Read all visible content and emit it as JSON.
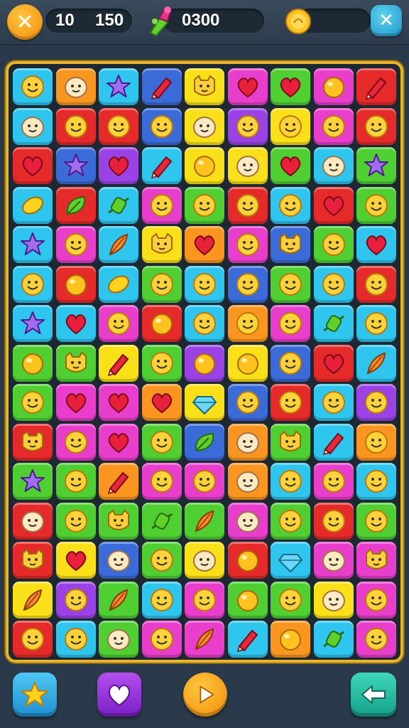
{
  "header": {
    "close_left_label": "✕",
    "close_right_label": "✕",
    "moves": "10",
    "score": "150",
    "gems": "0300",
    "gem_icon": "gem-bundle-icon",
    "coin_icon": "gold-coin-icon"
  },
  "colors": {
    "c": "#2ec6ee",
    "o": "#fa9620",
    "b": "#3a6bd8",
    "y": "#fae018",
    "m": "#e93dcc",
    "g": "#4fcf32",
    "r": "#e62a2a",
    "p": "#9a42e6"
  },
  "board": {
    "rows": [
      [
        {
          "bg": "c",
          "icon": "smiley"
        },
        {
          "bg": "o",
          "icon": "face"
        },
        {
          "bg": "c",
          "icon": "star"
        },
        {
          "bg": "b",
          "icon": "crayon"
        },
        {
          "bg": "y",
          "icon": "cat"
        },
        {
          "bg": "m",
          "icon": "heart"
        },
        {
          "bg": "g",
          "icon": "heart"
        },
        {
          "bg": "m",
          "icon": "ball"
        },
        {
          "bg": "r",
          "icon": "crayon"
        }
      ],
      [
        {
          "bg": "c",
          "icon": "face"
        },
        {
          "bg": "r",
          "icon": "smiley"
        },
        {
          "bg": "r",
          "icon": "smiley"
        },
        {
          "bg": "b",
          "icon": "smiley"
        },
        {
          "bg": "y",
          "icon": "face"
        },
        {
          "bg": "p",
          "icon": "smiley"
        },
        {
          "bg": "y",
          "icon": "smiley"
        },
        {
          "bg": "m",
          "icon": "smiley"
        },
        {
          "bg": "r",
          "icon": "smiley"
        }
      ],
      [
        {
          "bg": "r",
          "icon": "heart"
        },
        {
          "bg": "b",
          "icon": "star"
        },
        {
          "bg": "p",
          "icon": "heart"
        },
        {
          "bg": "c",
          "icon": "crayon"
        },
        {
          "bg": "y",
          "icon": "ball"
        },
        {
          "bg": "y",
          "icon": "face"
        },
        {
          "bg": "g",
          "icon": "heart"
        },
        {
          "bg": "c",
          "icon": "face"
        },
        {
          "bg": "g",
          "icon": "star"
        }
      ],
      [
        {
          "bg": "c",
          "icon": "lemon"
        },
        {
          "bg": "r",
          "icon": "leaf"
        },
        {
          "bg": "c",
          "icon": "candy"
        },
        {
          "bg": "m",
          "icon": "smiley"
        },
        {
          "bg": "g",
          "icon": "smiley"
        },
        {
          "bg": "r",
          "icon": "smiley"
        },
        {
          "bg": "c",
          "icon": "smiley"
        },
        {
          "bg": "r",
          "icon": "heart"
        },
        {
          "bg": "g",
          "icon": "smiley"
        }
      ],
      [
        {
          "bg": "c",
          "icon": "star"
        },
        {
          "bg": "m",
          "icon": "smiley"
        },
        {
          "bg": "c",
          "icon": "feather"
        },
        {
          "bg": "y",
          "icon": "cat"
        },
        {
          "bg": "o",
          "icon": "heart"
        },
        {
          "bg": "m",
          "icon": "smiley"
        },
        {
          "bg": "b",
          "icon": "cat"
        },
        {
          "bg": "g",
          "icon": "smiley"
        },
        {
          "bg": "c",
          "icon": "heart"
        }
      ],
      [
        {
          "bg": "c",
          "icon": "smiley"
        },
        {
          "bg": "r",
          "icon": "ball"
        },
        {
          "bg": "c",
          "icon": "lemon"
        },
        {
          "bg": "g",
          "icon": "smiley"
        },
        {
          "bg": "c",
          "icon": "smiley"
        },
        {
          "bg": "b",
          "icon": "smiley"
        },
        {
          "bg": "g",
          "icon": "smiley"
        },
        {
          "bg": "c",
          "icon": "smiley"
        },
        {
          "bg": "r",
          "icon": "smiley"
        }
      ],
      [
        {
          "bg": "c",
          "icon": "star"
        },
        {
          "bg": "c",
          "icon": "heart"
        },
        {
          "bg": "m",
          "icon": "smiley"
        },
        {
          "bg": "r",
          "icon": "ball"
        },
        {
          "bg": "c",
          "icon": "smiley"
        },
        {
          "bg": "o",
          "icon": "smiley"
        },
        {
          "bg": "m",
          "icon": "smiley"
        },
        {
          "bg": "c",
          "icon": "candy"
        },
        {
          "bg": "c",
          "icon": "smiley"
        }
      ],
      [
        {
          "bg": "g",
          "icon": "ball"
        },
        {
          "bg": "g",
          "icon": "cat"
        },
        {
          "bg": "y",
          "icon": "crayon"
        },
        {
          "bg": "g",
          "icon": "smiley"
        },
        {
          "bg": "p",
          "icon": "ball"
        },
        {
          "bg": "y",
          "icon": "ball"
        },
        {
          "bg": "b",
          "icon": "smiley"
        },
        {
          "bg": "r",
          "icon": "heart"
        },
        {
          "bg": "c",
          "icon": "feather"
        }
      ],
      [
        {
          "bg": "g",
          "icon": "smiley"
        },
        {
          "bg": "m",
          "icon": "heart"
        },
        {
          "bg": "m",
          "icon": "heart"
        },
        {
          "bg": "o",
          "icon": "heart"
        },
        {
          "bg": "y",
          "icon": "gem"
        },
        {
          "bg": "b",
          "icon": "smiley"
        },
        {
          "bg": "r",
          "icon": "smiley"
        },
        {
          "bg": "c",
          "icon": "smiley"
        },
        {
          "bg": "p",
          "icon": "smiley"
        }
      ],
      [
        {
          "bg": "r",
          "icon": "cat"
        },
        {
          "bg": "m",
          "icon": "smiley"
        },
        {
          "bg": "m",
          "icon": "heart"
        },
        {
          "bg": "g",
          "icon": "smiley"
        },
        {
          "bg": "b",
          "icon": "leaf"
        },
        {
          "bg": "o",
          "icon": "face"
        },
        {
          "bg": "g",
          "icon": "cat"
        },
        {
          "bg": "c",
          "icon": "crayon"
        },
        {
          "bg": "o",
          "icon": "smiley"
        }
      ],
      [
        {
          "bg": "g",
          "icon": "star"
        },
        {
          "bg": "g",
          "icon": "smiley"
        },
        {
          "bg": "o",
          "icon": "crayon"
        },
        {
          "bg": "m",
          "icon": "smiley"
        },
        {
          "bg": "m",
          "icon": "smiley"
        },
        {
          "bg": "o",
          "icon": "face"
        },
        {
          "bg": "c",
          "icon": "smiley"
        },
        {
          "bg": "m",
          "icon": "smiley"
        },
        {
          "bg": "c",
          "icon": "smiley"
        }
      ],
      [
        {
          "bg": "r",
          "icon": "face"
        },
        {
          "bg": "g",
          "icon": "smiley"
        },
        {
          "bg": "g",
          "icon": "cat"
        },
        {
          "bg": "g",
          "icon": "candy"
        },
        {
          "bg": "g",
          "icon": "feather"
        },
        {
          "bg": "m",
          "icon": "face"
        },
        {
          "bg": "g",
          "icon": "smiley"
        },
        {
          "bg": "r",
          "icon": "smiley"
        },
        {
          "bg": "g",
          "icon": "smiley"
        }
      ],
      [
        {
          "bg": "r",
          "icon": "cat"
        },
        {
          "bg": "y",
          "icon": "heart"
        },
        {
          "bg": "b",
          "icon": "face"
        },
        {
          "bg": "g",
          "icon": "smiley"
        },
        {
          "bg": "y",
          "icon": "face"
        },
        {
          "bg": "r",
          "icon": "ball"
        },
        {
          "bg": "c",
          "icon": "gem"
        },
        {
          "bg": "m",
          "icon": "face"
        },
        {
          "bg": "m",
          "icon": "cat"
        }
      ],
      [
        {
          "bg": "y",
          "icon": "feather"
        },
        {
          "bg": "p",
          "icon": "smiley"
        },
        {
          "bg": "g",
          "icon": "feather"
        },
        {
          "bg": "c",
          "icon": "smiley"
        },
        {
          "bg": "m",
          "icon": "smiley"
        },
        {
          "bg": "g",
          "icon": "ball"
        },
        {
          "bg": "g",
          "icon": "smiley"
        },
        {
          "bg": "y",
          "icon": "face"
        },
        {
          "bg": "m",
          "icon": "smiley"
        }
      ],
      [
        {
          "bg": "r",
          "icon": "smiley"
        },
        {
          "bg": "c",
          "icon": "smiley"
        },
        {
          "bg": "g",
          "icon": "face"
        },
        {
          "bg": "m",
          "icon": "smiley"
        },
        {
          "bg": "m",
          "icon": "feather"
        },
        {
          "bg": "c",
          "icon": "crayon"
        },
        {
          "bg": "o",
          "icon": "ball"
        },
        {
          "bg": "c",
          "icon": "candy"
        },
        {
          "bg": "m",
          "icon": "smiley"
        }
      ]
    ]
  },
  "footer": {
    "star_icon": "star-booster-icon",
    "heart_icon": "heart-booster-icon",
    "play_icon": "play-icon",
    "back_icon": "back-arrow-icon"
  }
}
